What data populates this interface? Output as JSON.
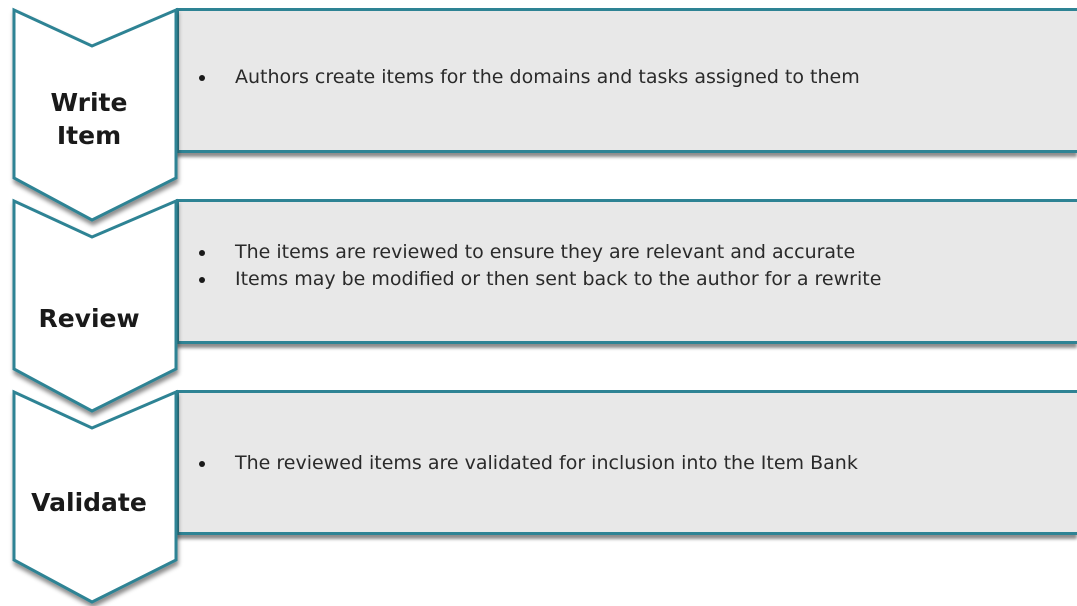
{
  "steps": [
    {
      "title_lines": [
        "Write",
        "Item"
      ],
      "bullets": [
        "Authors create items for the domains and tasks assigned to them"
      ]
    },
    {
      "title_lines": [
        "Review"
      ],
      "bullets": [
        "The items are reviewed to ensure they are relevant and accurate",
        "Items may be modified or then sent back to the author for a rewrite"
      ]
    },
    {
      "title_lines": [
        "Validate"
      ],
      "bullets": [
        "The reviewed items are validated for inclusion into the Item Bank"
      ]
    }
  ],
  "colors": {
    "border": "#2e8394",
    "box_fill": "#e8e8e8",
    "chevron_fill": "#ffffff",
    "text": "#2a2a2a"
  }
}
